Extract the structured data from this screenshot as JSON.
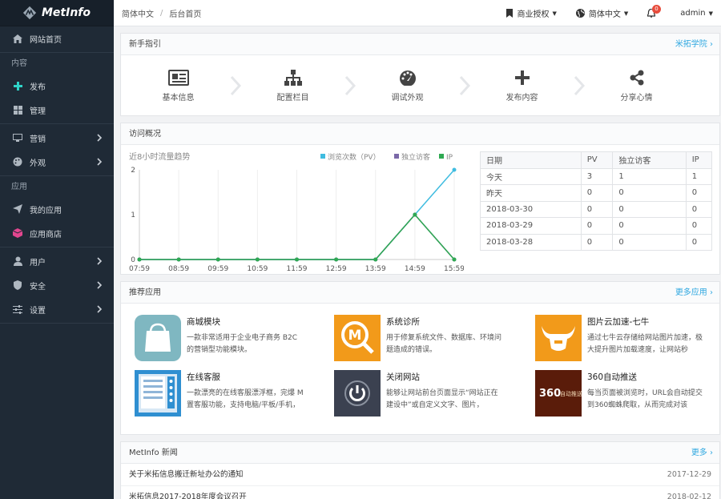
{
  "brand": {
    "name": "MetInfo"
  },
  "sidebar": {
    "home": "网站首页",
    "sec_content": "内容",
    "publish": "发布",
    "manage": "管理",
    "marketing": "营销",
    "appearance": "外观",
    "sec_apps": "应用",
    "my_apps": "我的应用",
    "app_store": "应用商店",
    "users": "用户",
    "security": "安全",
    "settings": "设置"
  },
  "topbar": {
    "breadcrumb": [
      "简体中文",
      "后台首页"
    ],
    "license": "商业授权",
    "language": "简体中文",
    "notifications": "0",
    "user": "admin"
  },
  "guide": {
    "title": "新手指引",
    "more": "米拓学院 ›",
    "steps": [
      "基本信息",
      "配置栏目",
      "调试外观",
      "发布内容",
      "分享心情"
    ]
  },
  "visits": {
    "title": "访问概况",
    "table_headers": [
      "日期",
      "PV",
      "独立访客",
      "IP"
    ],
    "rows": [
      [
        "今天",
        "3",
        "1",
        "1"
      ],
      [
        "昨天",
        "0",
        "0",
        "0"
      ],
      [
        "2018-03-30",
        "0",
        "0",
        "0"
      ],
      [
        "2018-03-29",
        "0",
        "0",
        "0"
      ],
      [
        "2018-03-28",
        "0",
        "0",
        "0"
      ]
    ]
  },
  "chart_data": {
    "type": "line",
    "title": "近8小时流量趋势",
    "categories": [
      "07:59",
      "08:59",
      "09:59",
      "10:59",
      "11:59",
      "12:59",
      "13:59",
      "14:59",
      "15:59"
    ],
    "series": [
      {
        "name": "浏览次数（PV）",
        "color": "#3fbce0",
        "values": [
          0,
          0,
          0,
          0,
          0,
          0,
          0,
          1,
          2
        ]
      },
      {
        "name": "独立访客",
        "color": "#7b69a8",
        "values": [
          0,
          0,
          0,
          0,
          0,
          0,
          0,
          1,
          0
        ]
      },
      {
        "name": "IP",
        "color": "#2fa952",
        "values": [
          0,
          0,
          0,
          0,
          0,
          0,
          0,
          1,
          0
        ]
      }
    ],
    "ylim": [
      0,
      2
    ],
    "yticks": [
      "0",
      "1",
      "2"
    ],
    "legend": "top-right",
    "grid": true
  },
  "apps": {
    "title": "推荐应用",
    "more": "更多应用 ›",
    "items": [
      {
        "name": "商城模块",
        "desc": "一款非常适用于企业电子商务 B2C 的营销型功能模块。"
      },
      {
        "name": "系统诊所",
        "desc": "用于修复系统文件、数据库、环境问题造成的错误。"
      },
      {
        "name": "图片云加速-七牛",
        "desc": "通过七牛云存储给网站图片加速，极大提升图片加载速度，让网站秒"
      },
      {
        "name": "在线客服",
        "desc": "一款漂亮的在线客服漂浮框，完爆 M 置客服功能，支持电脑/平板/手机，"
      },
      {
        "name": "关闭网站",
        "desc": "能够让网站前台页面显示“网站正在建设中”或自定义文字、图片，"
      },
      {
        "name": "360自动推送",
        "desc": "每当页面被浏览时，URL会自动提交到360蜘蛛爬取，从而完成对该"
      }
    ],
    "badge_360": "360",
    "badge_360_sub": "自动推送",
    "icon_m": "M"
  },
  "news": {
    "title": "MetInfo 新闻",
    "more": "更多 ›",
    "items": [
      {
        "title": "关于米拓信息搬迁新址办公的通知",
        "date": "2017-12-29"
      },
      {
        "title": "米拓信息2017-2018年度会议召开",
        "date": "2018-02-12"
      }
    ]
  }
}
